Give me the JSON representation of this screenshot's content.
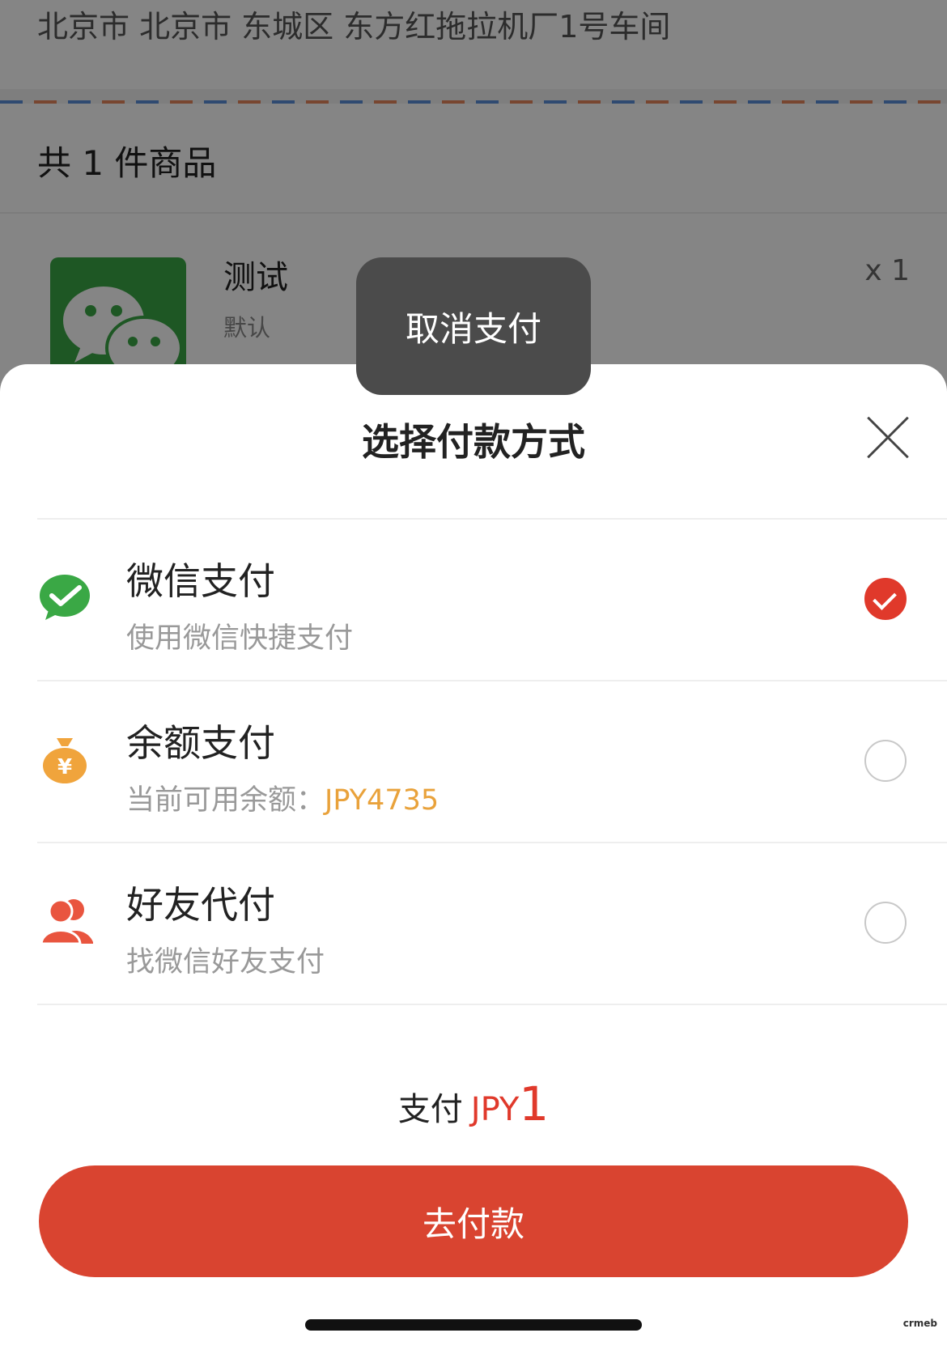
{
  "background": {
    "address": "北京市 北京市 东城区 东方红拖拉机厂1号车间",
    "item_count": "共 1 件商品",
    "product": {
      "name": "测试",
      "spec": "默认",
      "qty": "x 1",
      "thumb_icon": "wechat-icon"
    }
  },
  "toast": {
    "text": "取消支付"
  },
  "sheet": {
    "title": "选择付款方式",
    "options": [
      {
        "label": "微信支付",
        "desc": "使用微信快捷支付",
        "icon": "wechat-pay-icon",
        "selected": true
      },
      {
        "label": "余额支付",
        "desc_prefix": "当前可用余额：",
        "desc_value": "JPY4735",
        "icon": "money-bag-icon",
        "selected": false
      },
      {
        "label": "好友代付",
        "desc": "找微信好友支付",
        "icon": "friends-icon",
        "selected": false
      }
    ],
    "summary": {
      "prefix": "支付",
      "currency": "JPY",
      "amount": "1"
    },
    "pay_button": "去付款"
  },
  "watermark": "crmeb",
  "colors": {
    "accent": "#d94430",
    "wechat_green": "#3aa845",
    "balance_orange": "#e9a23b"
  }
}
